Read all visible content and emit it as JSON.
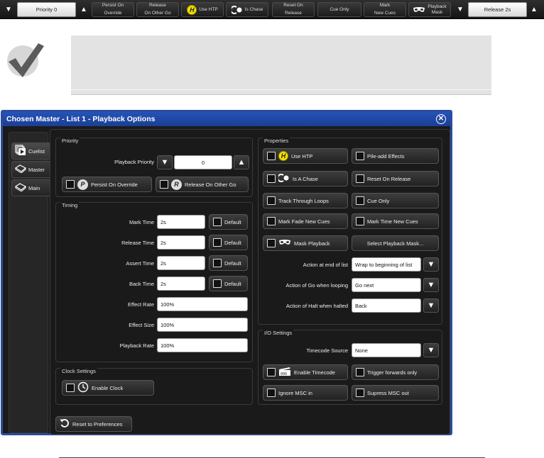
{
  "toolbar": {
    "priority_value": "Priority 0",
    "persist_on_override": [
      "Persist On",
      "Override"
    ],
    "release_on_other_go": [
      "Release",
      "On Other Go"
    ],
    "use_htp": "Use HTP",
    "is_chase": "Is Chase",
    "reset_on_release": [
      "Reset On",
      "Release"
    ],
    "cue_only": "Cue Only",
    "mark_new_cues": [
      "Mark",
      "New Cues"
    ],
    "playback_mask": [
      "Playback",
      "Mask"
    ],
    "release_value": "Release 2s",
    "icons": {
      "down": "triangle-down-icon",
      "up": "triangle-up-icon",
      "htp": "htp-h-icon",
      "chase": "chase-icon",
      "mask": "mask-icon"
    }
  },
  "dialog": {
    "title": "Chosen Master - List 1 - Playback Options",
    "tabs": [
      {
        "label": "Cuelist"
      },
      {
        "label": "Master"
      },
      {
        "label": "Main"
      }
    ],
    "priority": {
      "title": "Priority",
      "playback_priority_label": "Playback Priority",
      "playback_priority_value": "0",
      "persist_on_override": "Persist On Override",
      "release_on_other_go": "Release On Other Go"
    },
    "timing": {
      "title": "Timing",
      "rows": [
        {
          "label": "Mark Time",
          "value": "2s",
          "default": "Default"
        },
        {
          "label": "Release Time",
          "value": "2s",
          "default": "Default"
        },
        {
          "label": "Assert Time",
          "value": "2s",
          "default": "Default"
        },
        {
          "label": "Back Time",
          "value": "2s",
          "default": "Default"
        }
      ],
      "effect_rate_label": "Effect Rate",
      "effect_rate_value": "100%",
      "effect_size_label": "Effect Size",
      "effect_size_value": "100%",
      "playback_rate_label": "Playback Rate",
      "playback_rate_value": "100%"
    },
    "clock": {
      "title": "Clock Settings",
      "enable_clock": "Enable Clock"
    },
    "reset_to_preferences": "Reset to Preferences",
    "properties": {
      "title": "Properties",
      "use_htp": "Use HTP",
      "pile_add_effects": "Pile-add Effects",
      "is_a_chase": "Is A Chase",
      "reset_on_release": "Reset On Release",
      "track_through_loops": "Track Through Loops",
      "cue_only": "Cue Only",
      "mark_fade_new_cues": "Mark Fade New Cues",
      "mark_time_new_cues": "Mark Time New Cues",
      "mask_playback": "Mask Playback",
      "select_playback_mask": "Select Playback Mask...",
      "action_end_label": "Action at end of list",
      "action_end_value": "Wrap to beginning of list",
      "action_go_label": "Action of Go when looping",
      "action_go_value": "Go next",
      "action_halt_label": "Action of Halt when halted",
      "action_halt_value": "Back"
    },
    "io": {
      "title": "I/O Settings",
      "timecode_source_label": "Timecode Source",
      "timecode_source_value": "None",
      "enable_timecode": "Enable Timecode",
      "trigger_forwards_only": "Trigger forwards only",
      "ignore_msc_in": "Ignore MSC in",
      "supress_msc_out": "Supress MSC out"
    }
  },
  "colors": {
    "title_bar": "#2553b8",
    "htp_yellow": "#f3e000",
    "panel": "#1a1a1a"
  }
}
